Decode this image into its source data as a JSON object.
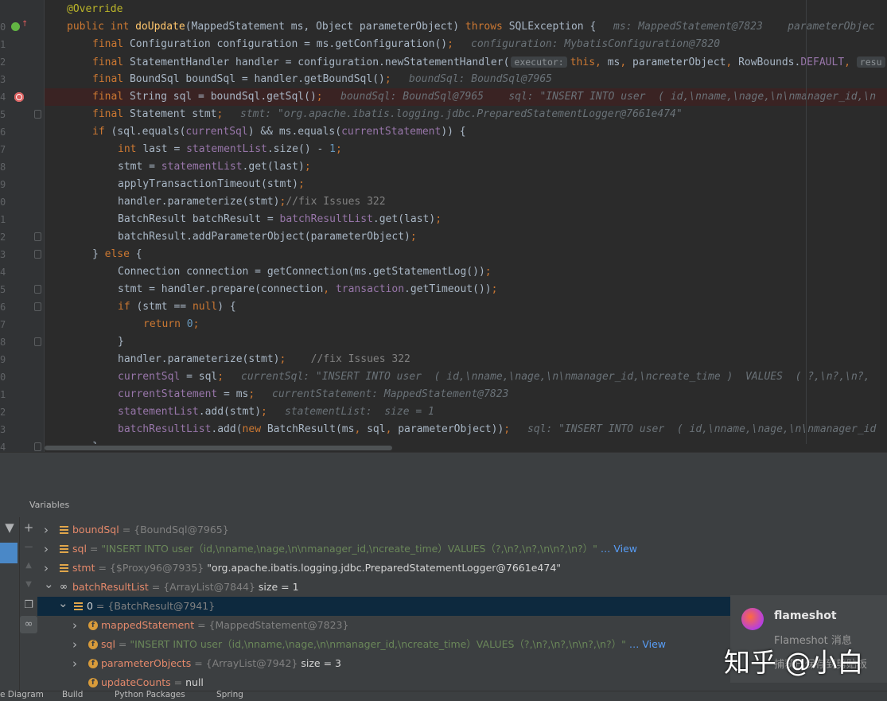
{
  "editor": {
    "lines": [
      {
        "num": "",
        "tokens": [
          [
            "a",
            "@Override"
          ]
        ],
        "indent": 1
      },
      {
        "num": "0",
        "tokens": [
          [
            "k",
            "public int "
          ],
          [
            "m",
            "doUpdate"
          ],
          [
            "",
            "(MappedStatement ms, Object parameterObject) "
          ],
          [
            "k",
            "throws "
          ],
          [
            "",
            "SQLException {"
          ]
        ],
        "indent": 1,
        "hint": "ms: MappedStatement@7823    parameterObjec"
      },
      {
        "num": "1",
        "tokens": [
          [
            "k",
            "final "
          ],
          [
            "",
            "Configuration configuration = ms.getConfiguration()"
          ],
          [
            "k",
            ";"
          ]
        ],
        "indent": 2,
        "hint": "configuration: MybatisConfiguration@7820"
      },
      {
        "num": "2",
        "tokens": [
          [
            "k",
            "final "
          ],
          [
            "",
            "StatementHandler handler = configuration.newStatementHandler("
          ]
        ],
        "indent": 2,
        "box": "executor:",
        "tail": [
          [
            "k",
            "this"
          ],
          [
            "k",
            ", "
          ],
          [
            "",
            "ms"
          ],
          [
            "k",
            ", "
          ],
          [
            "",
            "parameterObject"
          ],
          [
            "k",
            ", "
          ],
          [
            "",
            "RowBounds."
          ],
          [
            "f",
            "DEFAULT"
          ],
          [
            "k",
            ", "
          ]
        ],
        "tailbox": "resu"
      },
      {
        "num": "3",
        "tokens": [
          [
            "k",
            "final "
          ],
          [
            "",
            "BoundSql boundSql = handler.getBoundSql()"
          ],
          [
            "k",
            ";"
          ]
        ],
        "indent": 2,
        "hint": "boundSql: BoundSql@7965"
      },
      {
        "num": "4",
        "tokens": [
          [
            "k",
            "final "
          ],
          [
            "",
            "String sql = boundSql.getSql()"
          ],
          [
            "k",
            ";"
          ]
        ],
        "indent": 2,
        "hint": "boundSql: BoundSql@7965    sql: \"INSERT INTO user  ( id,\\nname,\\nage,\\n\\nmanager_id,\\n",
        "bp": true
      },
      {
        "num": "5",
        "tokens": [
          [
            "k",
            "final "
          ],
          [
            "",
            "Statement stmt"
          ],
          [
            "k",
            ";"
          ]
        ],
        "indent": 2,
        "hint": "stmt: \"org.apache.ibatis.logging.jdbc.PreparedStatementLogger@7661e474\""
      },
      {
        "num": "6",
        "tokens": [
          [
            "k",
            "if "
          ],
          [
            "",
            "(sql.equals("
          ],
          [
            "f",
            "currentSql"
          ],
          [
            "",
            ") && ms.equals("
          ],
          [
            "f",
            "currentStatement"
          ],
          [
            "",
            ")) {"
          ]
        ],
        "indent": 2
      },
      {
        "num": "7",
        "tokens": [
          [
            "k",
            "int "
          ],
          [
            "",
            "last = "
          ],
          [
            "f",
            "statementList"
          ],
          [
            "",
            ".size() - "
          ],
          [
            "n",
            "1"
          ],
          [
            "k",
            ";"
          ]
        ],
        "indent": 3
      },
      {
        "num": "8",
        "tokens": [
          [
            "",
            "stmt = "
          ],
          [
            "f",
            "statementList"
          ],
          [
            "",
            ".get(last)"
          ],
          [
            "k",
            ";"
          ]
        ],
        "indent": 3
      },
      {
        "num": "9",
        "tokens": [
          [
            "",
            "applyTransactionTimeout(stmt)"
          ],
          [
            "k",
            ";"
          ]
        ],
        "indent": 3
      },
      {
        "num": "0",
        "tokens": [
          [
            "",
            "handler.parameterize(stmt)"
          ],
          [
            "k",
            ";"
          ],
          [
            "c",
            "//fix Issues 322"
          ]
        ],
        "indent": 3
      },
      {
        "num": "1",
        "tokens": [
          [
            "",
            "BatchResult batchResult = "
          ],
          [
            "f",
            "batchResultList"
          ],
          [
            "",
            ".get(last)"
          ],
          [
            "k",
            ";"
          ]
        ],
        "indent": 3
      },
      {
        "num": "2",
        "tokens": [
          [
            "",
            "batchResult.addParameterObject(parameterObject)"
          ],
          [
            "k",
            ";"
          ]
        ],
        "indent": 3
      },
      {
        "num": "3",
        "tokens": [
          [
            "",
            "} "
          ],
          [
            "k",
            "else "
          ],
          [
            "",
            "{"
          ]
        ],
        "indent": 2
      },
      {
        "num": "4",
        "tokens": [
          [
            "",
            "Connection connection = getConnection(ms.getStatementLog())"
          ],
          [
            "k",
            ";"
          ]
        ],
        "indent": 3
      },
      {
        "num": "5",
        "tokens": [
          [
            "",
            "stmt = handler.prepare(connection"
          ],
          [
            "k",
            ", "
          ],
          [
            "f",
            "transaction"
          ],
          [
            "",
            ".getTimeout())"
          ],
          [
            "k",
            ";"
          ]
        ],
        "indent": 3
      },
      {
        "num": "6",
        "tokens": [
          [
            "k",
            "if "
          ],
          [
            "",
            "(stmt == "
          ],
          [
            "k",
            "null"
          ],
          [
            "",
            ") {"
          ]
        ],
        "indent": 3
      },
      {
        "num": "7",
        "tokens": [
          [
            "k",
            "return "
          ],
          [
            "n",
            "0"
          ],
          [
            "k",
            ";"
          ]
        ],
        "indent": 4
      },
      {
        "num": "8",
        "tokens": [
          [
            "",
            "}"
          ]
        ],
        "indent": 3
      },
      {
        "num": "9",
        "tokens": [
          [
            "",
            "handler.parameterize(stmt)"
          ],
          [
            "k",
            ";"
          ],
          [
            "",
            "    "
          ],
          [
            "c",
            "//fix Issues 322"
          ]
        ],
        "indent": 3
      },
      {
        "num": "0",
        "tokens": [
          [
            "f",
            "currentSql"
          ],
          [
            "",
            " = sql"
          ],
          [
            "k",
            ";"
          ]
        ],
        "indent": 3,
        "hint": "currentSql: \"INSERT INTO user  ( id,\\nname,\\nage,\\n\\nmanager_id,\\ncreate_time )  VALUES  ( ?,\\n?,\\n?,"
      },
      {
        "num": "1",
        "tokens": [
          [
            "f",
            "currentStatement"
          ],
          [
            "",
            " = ms"
          ],
          [
            "k",
            ";"
          ]
        ],
        "indent": 3,
        "hint": "currentStatement: MappedStatement@7823"
      },
      {
        "num": "2",
        "tokens": [
          [
            "f",
            "statementList"
          ],
          [
            "",
            ".add(stmt)"
          ],
          [
            "k",
            ";"
          ]
        ],
        "indent": 3,
        "hint": "statementList:  size = 1"
      },
      {
        "num": "3",
        "tokens": [
          [
            "f",
            "batchResultList"
          ],
          [
            "",
            ".add("
          ],
          [
            "k",
            "new "
          ],
          [
            "",
            "BatchResult(ms"
          ],
          [
            "k",
            ", "
          ],
          [
            "",
            "sql"
          ],
          [
            "k",
            ", "
          ],
          [
            "",
            "parameterObject))"
          ],
          [
            "k",
            ";"
          ]
        ],
        "indent": 3,
        "hint": "sql: \"INSERT INTO user  ( id,\\nname,\\nage,\\n\\nmanager_id"
      },
      {
        "num": "4",
        "tokens": [
          [
            "",
            "}"
          ]
        ],
        "indent": 2
      }
    ]
  },
  "debug": {
    "panel_title": "Variables",
    "variables": [
      {
        "name": "boundSql",
        "type": "{BoundSql@7965}",
        "value": "",
        "icon": "field",
        "level": 0,
        "chev": ">"
      },
      {
        "name": "sql",
        "type": "",
        "value": "\"INSERT INTO user（id,\\nname,\\nage,\\n\\nmanager_id,\\ncreate_time）VALUES（?,\\n?,\\n?,\\n\\n?,\\n?）\"",
        "link": "… View",
        "icon": "field",
        "level": 0,
        "chev": ">",
        "strval": true
      },
      {
        "name": "stmt",
        "type": "{$Proxy96@7935}",
        "value": "\"org.apache.ibatis.logging.jdbc.PreparedStatementLogger@7661e474\"",
        "icon": "field",
        "level": 0,
        "chev": ">",
        "plain": true
      },
      {
        "name": "batchResultList",
        "type": "{ArrayList@7844}",
        "value": "size = 1",
        "icon": "watch",
        "level": 0,
        "chev": "v"
      },
      {
        "name": "0",
        "type": "{BatchResult@7941}",
        "value": "",
        "icon": "field",
        "level": 1,
        "chev": "v",
        "selected": true,
        "plainname": true
      },
      {
        "name": "mappedStatement",
        "type": "{MappedStatement@7823}",
        "value": "",
        "icon": "final",
        "level": 2,
        "chev": ">"
      },
      {
        "name": "sql",
        "type": "",
        "value": "\"INSERT INTO user（id,\\nname,\\nage,\\n\\nmanager_id,\\ncreate_time）VALUES（?,\\n?,\\n?,\\n\\n?,\\n?）\"",
        "link": "… View",
        "icon": "final",
        "level": 2,
        "chev": ">",
        "strval": true
      },
      {
        "name": "parameterObjects",
        "type": "{ArrayList@7942}",
        "value": "size = 3",
        "icon": "final",
        "level": 2,
        "chev": ">"
      },
      {
        "name": "updateCounts",
        "type": "",
        "value": "null",
        "icon": "final",
        "level": 2,
        "chev": ""
      }
    ]
  },
  "notification": {
    "title": "flameshot",
    "message": "Flameshot 消息",
    "message2": "捕获已保存到剪贴板"
  },
  "watermark": "知乎 @小白",
  "bottom_tabs": [
    "e Diagram",
    "Build",
    "Python Packages",
    "Spring"
  ],
  "colors": {
    "keyword": "#cc7832",
    "method": "#ffc66d",
    "annotation": "#bbb529",
    "field": "#9876aa",
    "number": "#6897bb",
    "comment": "#808080",
    "string": "#6a8759",
    "breakpoint": "#db5c5c"
  }
}
